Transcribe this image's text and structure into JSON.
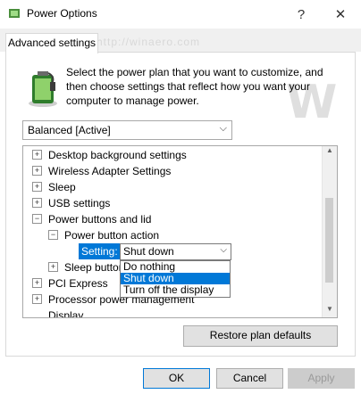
{
  "window": {
    "title": "Power Options",
    "controls": [
      "?",
      "✕"
    ]
  },
  "tab": {
    "label": "Advanced settings"
  },
  "intro_text": "Select the power plan that you want to customize, and then choose settings that reflect how you want your computer to manage power.",
  "plan_select": {
    "value": "Balanced [Active]"
  },
  "tree": {
    "items": [
      "Desktop background settings",
      "Wireless Adapter Settings",
      "Sleep",
      "USB settings",
      "Power buttons and lid",
      "Power button action",
      "Sleep button",
      "PCI Express",
      "Processor power management",
      "Display"
    ],
    "setting_label": "Setting:",
    "setting_value": "Shut down",
    "dropdown_options": [
      "Do nothing",
      "Shut down",
      "Turn off the display"
    ],
    "dropdown_selected": "Shut down"
  },
  "buttons": {
    "restore": "Restore plan defaults",
    "ok": "OK",
    "cancel": "Cancel",
    "apply": "Apply"
  },
  "watermark": {
    "text": "http://winaero.com",
    "glyph": "W"
  },
  "colors": {
    "accent": "#0078d7"
  }
}
